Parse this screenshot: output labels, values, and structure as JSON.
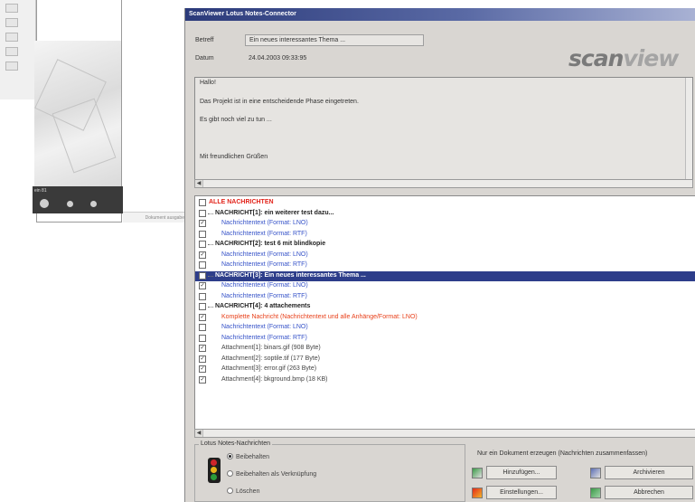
{
  "background_window": {
    "taskbar_label": "ein 81",
    "status_text": "Dokument ausgabe"
  },
  "dialog": {
    "title": "ScanViewer Lotus Notes-Connector",
    "header": {
      "subject_label": "Betreff",
      "subject_value": "Ein neues interessantes Thema ...",
      "date_label": "Datum",
      "date_value": "24.04.2003 09:33:95"
    },
    "logo": {
      "main": "scan",
      "accent": "view"
    },
    "body_lines": [
      "Hallo!",
      "Das Projekt ist in eine entscheidende Phase eingetreten.",
      "Es gibt noch viel zu tun ...",
      "",
      "Mit freundlichen Grüßen"
    ],
    "messages": [
      {
        "text": "ALLE NACHRICHTEN",
        "style": "red",
        "indent": 0,
        "checked": false,
        "selected": false
      },
      {
        "text": "NACHRICHT[1]: ein weiterer test dazu...",
        "style": "dark",
        "indent": 1,
        "checked": false,
        "selected": false
      },
      {
        "text": "Nachrichtentext (Format: LNO)",
        "style": "blue",
        "indent": 2,
        "checked": true,
        "selected": false
      },
      {
        "text": "Nachrichtentext (Format: RTF)",
        "style": "blue",
        "indent": 2,
        "checked": false,
        "selected": false
      },
      {
        "text": "NACHRICHT[2]: test 6 mit blindkopie",
        "style": "dark",
        "indent": 1,
        "checked": false,
        "selected": false
      },
      {
        "text": "Nachrichtentext (Format: LNO)",
        "style": "blue",
        "indent": 2,
        "checked": true,
        "selected": false
      },
      {
        "text": "Nachrichtentext (Format: RTF)",
        "style": "blue",
        "indent": 2,
        "checked": false,
        "selected": false
      },
      {
        "text": "NACHRICHT[3]: Ein neues interessantes Thema ...",
        "style": "dark",
        "indent": 1,
        "checked": false,
        "selected": true
      },
      {
        "text": "Nachrichtentext (Format: LNO)",
        "style": "blue",
        "indent": 2,
        "checked": true,
        "selected": false
      },
      {
        "text": "Nachrichtentext (Format: RTF)",
        "style": "blue",
        "indent": 2,
        "checked": false,
        "selected": false
      },
      {
        "text": "NACHRICHT[4]: 4 attachements",
        "style": "dark",
        "indent": 1,
        "checked": false,
        "selected": false
      },
      {
        "text": "Komplette Nachricht (Nachrichtentext und alle Anhänge/Format: LNO)",
        "style": "orange",
        "indent": 2,
        "checked": true,
        "selected": false
      },
      {
        "text": "Nachrichtentext (Format: LNO)",
        "style": "blue",
        "indent": 2,
        "checked": false,
        "selected": false
      },
      {
        "text": "Nachrichtentext (Format: RTF)",
        "style": "blue",
        "indent": 2,
        "checked": false,
        "selected": false
      },
      {
        "text": "Attachment[1]: binars.gif (908 Byte)",
        "style": "gray",
        "indent": 2,
        "checked": true,
        "selected": false
      },
      {
        "text": "Attachment[2]: soptile.tif (177 Byte)",
        "style": "gray",
        "indent": 2,
        "checked": true,
        "selected": false
      },
      {
        "text": "Attachment[3]: error.gif (263 Byte)",
        "style": "gray",
        "indent": 2,
        "checked": true,
        "selected": false
      },
      {
        "text": "Attachment[4]: bkground.bmp (18 KB)",
        "style": "gray",
        "indent": 2,
        "checked": true,
        "selected": false
      }
    ],
    "notes_group": {
      "title": "Lotus Notes-Nachrichten",
      "options": [
        "Beibehalten",
        "Beibehalten als Verknüpfung",
        "Löschen"
      ],
      "selected_index": 0
    },
    "hint_text": "Nur ein Dokument erzeugen (Nachrichten zusammenfassen)",
    "buttons": {
      "add": "Hinzufügen...",
      "archive": "Archivieren",
      "settings": "Einstellungen...",
      "cancel": "Abbrechen"
    }
  },
  "colors": {
    "title_bar": "#2b3a7a",
    "selection": "#2d3d8a",
    "red_text": "#e2231a",
    "blue_text": "#3552c8",
    "orange_text": "#e8401a"
  }
}
